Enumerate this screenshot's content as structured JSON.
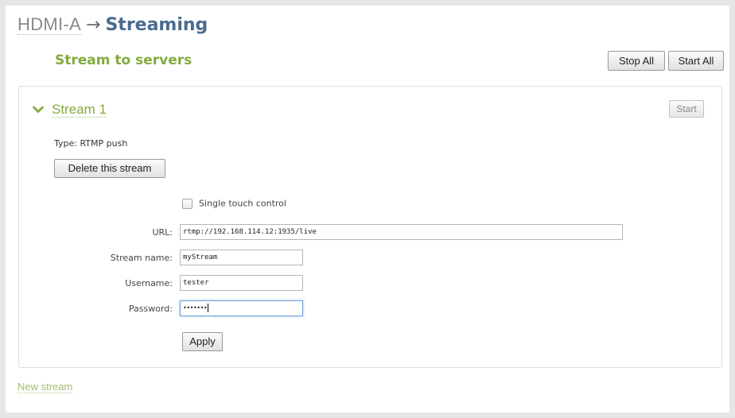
{
  "breadcrumb": {
    "parent": "HDMI-A",
    "arrow": "→",
    "current": "Streaming"
  },
  "section": {
    "title": "Stream to servers",
    "stop_all_label": "Stop All",
    "start_all_label": "Start All"
  },
  "stream": {
    "title": "Stream 1",
    "start_label": "Start",
    "type_text": "Type: RTMP push",
    "delete_label": "Delete this stream",
    "single_touch_label": "Single touch control",
    "single_touch_checked": false,
    "url_label": "URL:",
    "url_value": "rtmp://192.168.114.12:1935/live",
    "stream_name_label": "Stream name:",
    "stream_name_value": "myStream",
    "username_label": "Username:",
    "username_value": "tester",
    "password_label": "Password:",
    "password_masked": "•••••••",
    "apply_label": "Apply"
  },
  "new_stream_label": "New stream",
  "colors": {
    "accent_green": "#82ab3e",
    "title_blue": "#4b6a90",
    "focus_blue": "#6fa0d8"
  },
  "icons": {
    "collapse": "chevron-down-icon",
    "checkbox": "checkbox-icon"
  }
}
